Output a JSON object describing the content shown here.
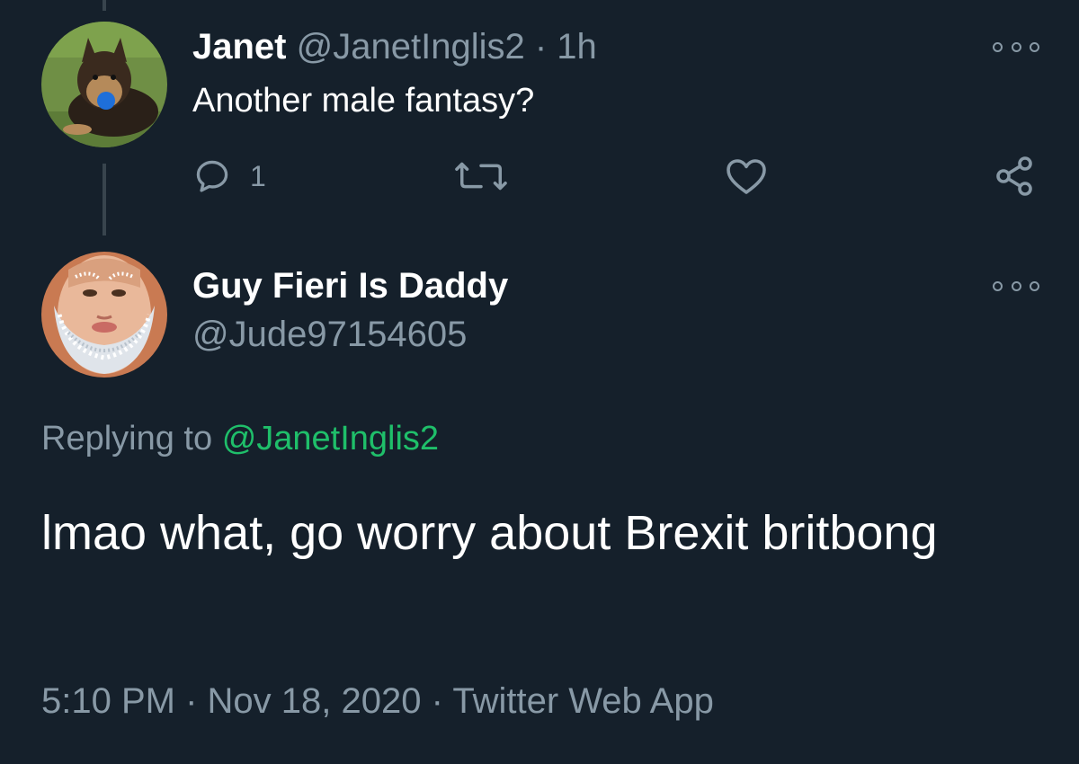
{
  "parent_tweet": {
    "display_name": "Janet",
    "handle": "@JanetInglis2",
    "separator": "·",
    "time": "1h",
    "text": "Another male fantasy?",
    "reply_count": "1",
    "avatar_icon": "dog-avatar"
  },
  "reply_tweet": {
    "display_name": "Guy Fieri Is Daddy",
    "handle": "@Jude97154605",
    "replying_prefix": "Replying to",
    "replying_to": "@JanetInglis2",
    "text": "lmao what, go worry about Brexit britbong",
    "time": "5:10 PM",
    "separator": "·",
    "date": "Nov 18, 2020",
    "source": "Twitter Web App",
    "avatar_icon": "jeweled-beard-avatar"
  },
  "colors": {
    "background": "#15202b",
    "muted": "#8899a6",
    "mention": "#1fbf6a",
    "thread_line": "#38444d"
  },
  "icons": [
    "more-icon",
    "reply-icon",
    "retweet-icon",
    "like-icon",
    "share-icon"
  ]
}
